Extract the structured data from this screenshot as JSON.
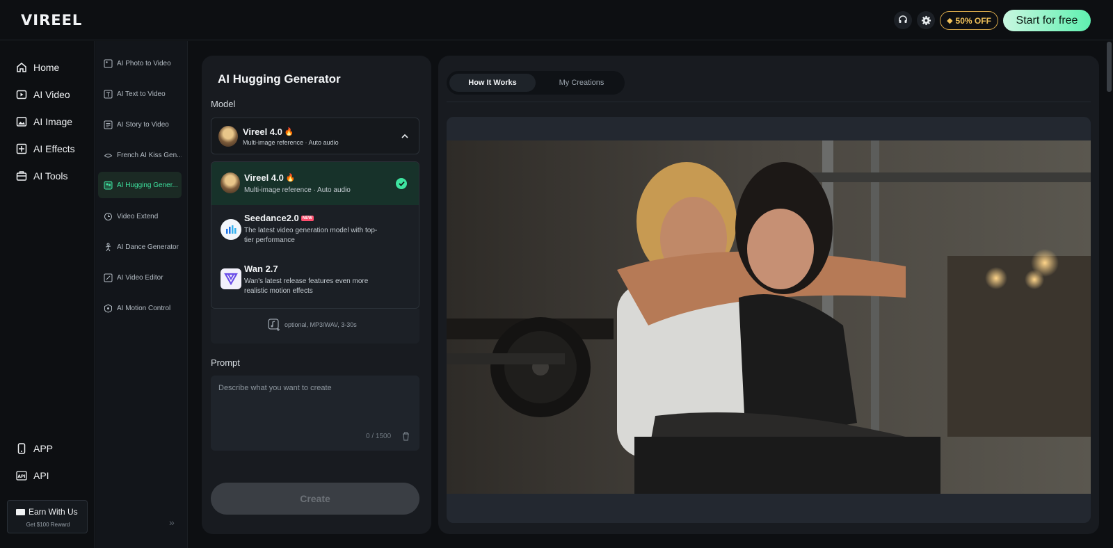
{
  "topbar": {
    "logo": "VIREEL",
    "promo_label": "50% OFF",
    "start_label": "Start for free",
    "support_icon": "headset-icon",
    "settings_icon": "gear-icon"
  },
  "nav_primary": {
    "items": [
      {
        "label": "Home",
        "icon": "home-icon"
      },
      {
        "label": "AI Video",
        "icon": "video-icon"
      },
      {
        "label": "AI Image",
        "icon": "image-icon"
      },
      {
        "label": "AI Effects",
        "icon": "effects-icon"
      },
      {
        "label": "AI Tools",
        "icon": "toolbox-icon"
      }
    ],
    "bottom": [
      {
        "label": "APP",
        "icon": "phone-icon"
      },
      {
        "label": "API",
        "icon": "api-icon"
      }
    ],
    "earn": {
      "title": "Earn With Us",
      "subtitle": "Get $100 Reward"
    }
  },
  "nav_secondary": {
    "items": [
      {
        "label": "AI Photo to Video"
      },
      {
        "label": "AI Text to Video"
      },
      {
        "label": "AI Story to Video"
      },
      {
        "label": "French AI Kiss Gen..."
      },
      {
        "label": "AI Hugging Gener...",
        "active": true
      },
      {
        "label": "Video Extend"
      },
      {
        "label": "AI Dance Generator"
      },
      {
        "label": "AI Video Editor"
      },
      {
        "label": "AI Motion Control"
      }
    ]
  },
  "generator": {
    "title": "AI Hugging Generator",
    "model_label": "Model",
    "selected_model": {
      "name": "Vireel 4.0",
      "subtitle": "Multi-image reference · Auto audio"
    },
    "options": [
      {
        "name": "Vireel 4.0",
        "subtitle": "Multi-image reference · Auto audio",
        "selected": true
      },
      {
        "name": "Seedance2.0",
        "badge": "NEW",
        "subtitle_line1": "The latest video generation model with top-",
        "subtitle_line2": "tier performance"
      },
      {
        "name": "Wan 2.7",
        "subtitle_line1": "Wan's latest release features even more",
        "subtitle_line2": "realistic motion effects"
      }
    ],
    "audio_hint": "optional, MP3/WAV, 3-30s",
    "prompt_label": "Prompt",
    "prompt_placeholder": "Describe what you want to create",
    "char_count": "0 / 1500",
    "create_label": "Create"
  },
  "preview": {
    "tabs": [
      {
        "label": "How It Works",
        "active": true
      },
      {
        "label": "My Creations"
      }
    ]
  },
  "colors": {
    "accent": "#3ee4a0",
    "promo": "#f1c25a",
    "panel": "#181b20"
  }
}
